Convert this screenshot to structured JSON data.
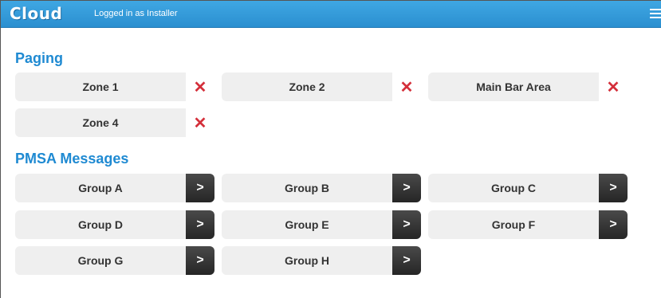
{
  "header": {
    "logo_text": "Cloud",
    "login_status": "Logged in as Installer",
    "menu_icon": "hamburger-menu-icon",
    "bar_color": "#3399dd"
  },
  "paging": {
    "title": "Paging",
    "delete_icon": "red-x-icon",
    "zones": [
      {
        "label": "Zone 1"
      },
      {
        "label": "Zone 2"
      },
      {
        "label": "Main Bar Area"
      },
      {
        "label": "Zone 4"
      }
    ]
  },
  "pmsa": {
    "title": "PMSA Messages",
    "arrow_glyph": ">",
    "groups": [
      {
        "label": "Group A"
      },
      {
        "label": "Group B"
      },
      {
        "label": "Group C"
      },
      {
        "label": "Group D"
      },
      {
        "label": "Group E"
      },
      {
        "label": "Group F"
      },
      {
        "label": "Group G"
      },
      {
        "label": "Group H"
      }
    ]
  },
  "colors": {
    "accent": "#1f8ad2",
    "delete": "#d42f3a",
    "button_bg": "#efefef",
    "arrow_bg": "#333333"
  }
}
